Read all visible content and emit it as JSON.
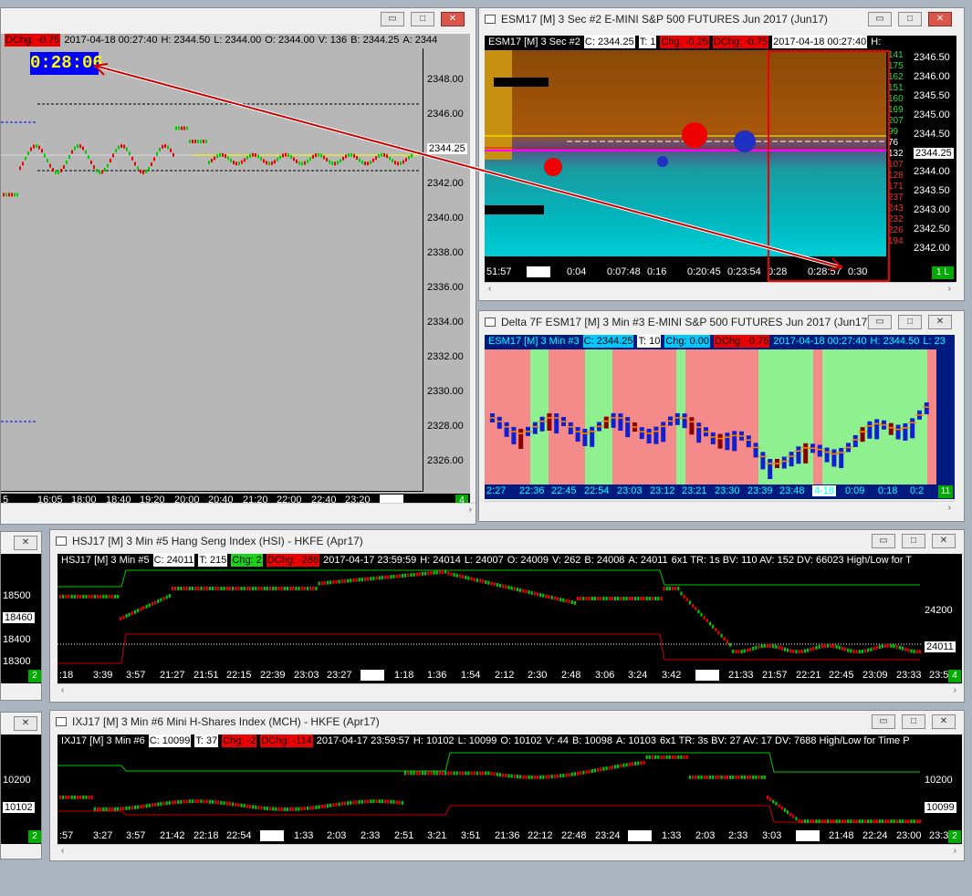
{
  "w1": {
    "info": {
      "dchg": "DChg: -0.75",
      "time": "2017-04-18 00:27:40",
      "h": "H: 2344.50",
      "l": "L: 2344.00",
      "o": "O: 2344.00",
      "v": "V: 136",
      "b": "B: 2344.25",
      "a": "A: 2344"
    },
    "timer": "0:28:06",
    "yticks": [
      "2348.00",
      "2346.00",
      "2344.25",
      "2342.00",
      "2340.00",
      "2338.00",
      "2336.00",
      "2334.00",
      "2332.00",
      "2330.00",
      "2328.00",
      "2326.00"
    ],
    "xticks": [
      "5",
      "16:05",
      "18:00",
      "18:40",
      "19:20",
      "20:00",
      "20:40",
      "21:20",
      "22:00",
      "22:40",
      "23:20",
      "4-18"
    ],
    "badge": "4"
  },
  "w2": {
    "title": "ESM17 [M]  3 Sec   #2  E-MINI S&P 500 FUTURES Jun 2017 (Jun17)",
    "info": {
      "sym": "ESM17 [M]  3 Sec  #2",
      "c": "C: 2344.25",
      "t": "T: 1",
      "chg": "Chg: -0.25",
      "dchg": "DChg: -0.75",
      "time": "2017-04-18 00:27:40",
      "h": "H:"
    },
    "vol": [
      "141",
      "175",
      "162",
      "151",
      "160",
      "169",
      "207",
      "99",
      "76",
      "132",
      "107",
      "128",
      "171",
      "237",
      "243",
      "232",
      "226",
      "194"
    ],
    "yticks": [
      "2346.50",
      "2346.00",
      "2345.50",
      "2345.00",
      "2344.50",
      "2344.25",
      "2344.00",
      "2343.50",
      "2343.00",
      "2342.50",
      "2342.00"
    ],
    "xticks": [
      "51:57",
      "4-18",
      "0:04",
      "0:07:48",
      "0:16",
      "0:20:45",
      "0:23:54",
      "0:28",
      "0:28:57",
      "0:30"
    ],
    "badge": "1 L"
  },
  "w3": {
    "title": "Delta 7F  ESM17 [M]  3 Min   #3  E-MINI S&P 500 FUTURES Jun 2017 (Jun17)",
    "info": {
      "sym": "ESM17 [M]  3 Min  #3",
      "c": "C: 2344.25",
      "t": "T: 10",
      "chg": "Chg: 0.00",
      "dchg": "DChg: -0.75",
      "time": "2017-04-18 00:27:40",
      "h": "H: 2344.50",
      "l": "L: 23"
    },
    "xticks": [
      "2:27",
      "22:36",
      "22:45",
      "22:54",
      "23:03",
      "23:12",
      "23:21",
      "23:30",
      "23:39",
      "23:48",
      "4-18",
      "0:09",
      "0:18",
      "0:2"
    ],
    "badge": "11"
  },
  "w4": {
    "title": "HSJ17 [M]  3 Min   #5  Hang Seng Index (HSI) - HKFE (Apr17)",
    "info": {
      "sym": "HSJ17 [M]  3 Min   #5",
      "c": "C: 24011",
      "t": "T: 215",
      "chg": "Chg: 2",
      "dchg": "DChg: -286",
      "time": "2017-04-17 23:59:59",
      "h": "H: 24014",
      "l": "L: 24007",
      "o": "O: 24009",
      "v": "V: 262",
      "b": "B: 24008",
      "a": "A: 24011",
      "rest": "6x1  TR: 1s  BV: 110  AV: 152  DV: 66023   High/Low for T"
    },
    "yticks": [
      "24200",
      "24011"
    ],
    "xticks": [
      ":18",
      "3:39",
      "3:57",
      "21:27",
      "21:51",
      "22:15",
      "22:39",
      "23:03",
      "23:27",
      "4-13",
      "1:18",
      "1:36",
      "1:54",
      "2:12",
      "2:30",
      "2:48",
      "3:06",
      "3:24",
      "3:42",
      "4-17",
      "21:33",
      "21:57",
      "22:21",
      "22:45",
      "23:09",
      "23:33",
      "23:57"
    ],
    "badge": "4"
  },
  "w5": {
    "title": "IXJ17 [M]  3 Min   #6  Mini H-Shares Index (MCH) - HKFE (Apr17)",
    "info": {
      "sym": "IXJ17 [M]  3 Min   #6",
      "c": "C: 10099",
      "t": "T: 37",
      "chg": "Chg: -2",
      "dchg": "DChg: -114",
      "time": "2017-04-17 23:59:57",
      "h": "H: 10102",
      "l": "L: 10099",
      "o": "O: 10102",
      "v": "V: 44",
      "b": "B: 10098",
      "a": "A: 10103",
      "rest": "6x1  TR: 3s  BV: 27  AV: 17  DV: 7688   High/Low for Time P"
    },
    "yticks": [
      "10200",
      "10099"
    ],
    "xticks": [
      ":57",
      "3:27",
      "3:57",
      "21:42",
      "22:18",
      "22:54",
      "4-12",
      "1:33",
      "2:03",
      "2:33",
      "2:51",
      "3:21",
      "3:51",
      "21:36",
      "22:12",
      "22:48",
      "23:24",
      "4-13",
      "1:33",
      "2:03",
      "2:33",
      "3:03",
      "4-17",
      "21:48",
      "22:24",
      "23:00",
      "23:36"
    ],
    "badge": "2"
  },
  "lw4": {
    "yticks": [
      "18500",
      "18460",
      "18400",
      "18300"
    ],
    "badge": "2"
  },
  "lw5": {
    "yticks": [
      "10200",
      "10102"
    ],
    "badge": "2"
  }
}
